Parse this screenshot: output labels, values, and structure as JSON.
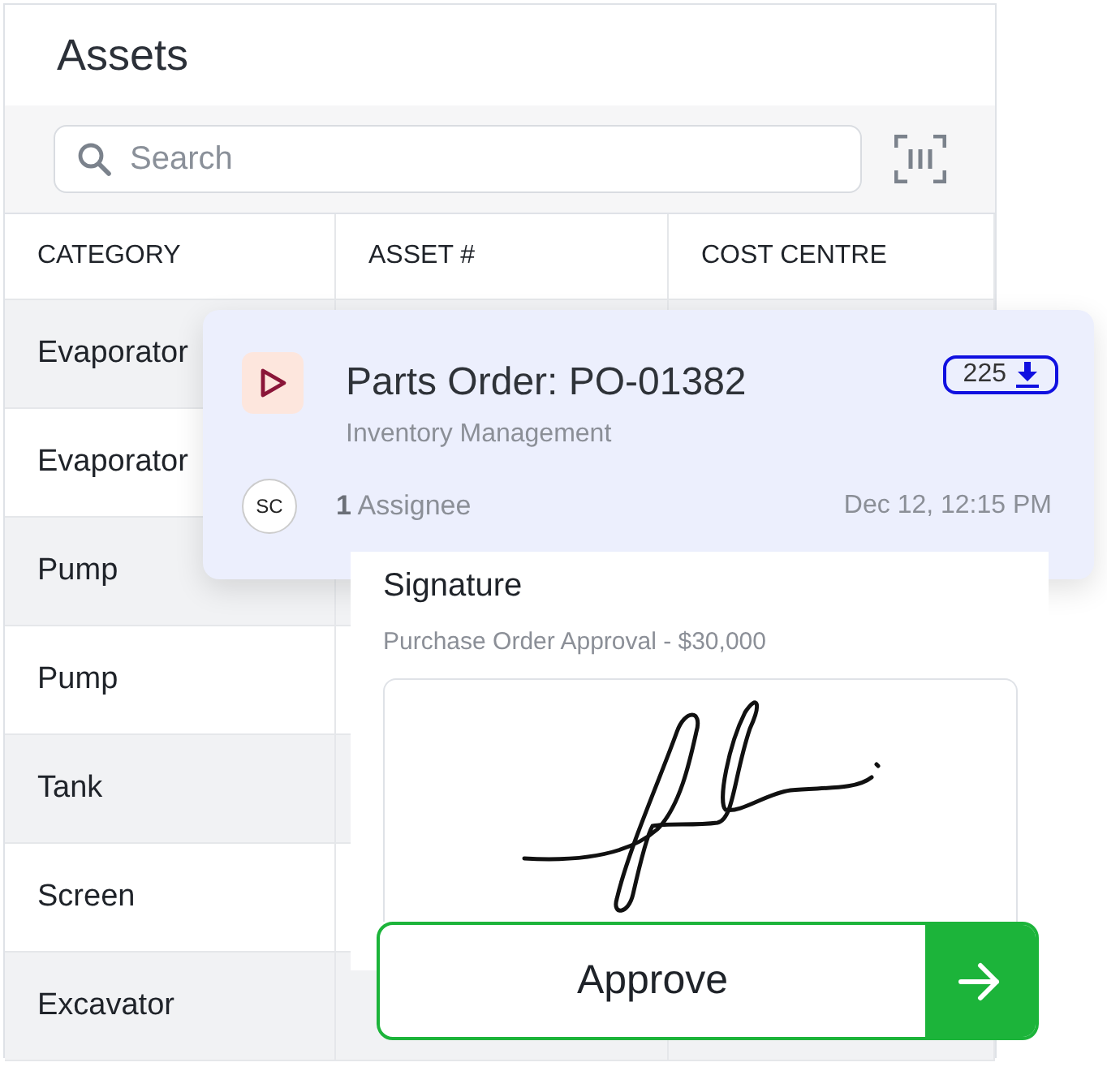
{
  "title": "Assets",
  "search": {
    "placeholder": "Search"
  },
  "table": {
    "columns": [
      "CATEGORY",
      "ASSET #",
      "COST CENTRE"
    ],
    "rows": [
      {
        "category": "Evaporator"
      },
      {
        "category": "Evaporator"
      },
      {
        "category": "Pump"
      },
      {
        "category": "Pump"
      },
      {
        "category": "Tank"
      },
      {
        "category": "Screen"
      },
      {
        "category": "Excavator"
      }
    ]
  },
  "order_card": {
    "title": "Parts Order: PO-01382",
    "count": "225",
    "subtitle": "Inventory Management",
    "avatar": "SC",
    "assignee_count": "1",
    "assignee_label": "Assignee",
    "date": "Dec 12, 12:15 PM"
  },
  "signature_card": {
    "title": "Signature",
    "subtitle": "Purchase Order Approval - $30,000"
  },
  "approve_button": {
    "label": "Approve"
  }
}
